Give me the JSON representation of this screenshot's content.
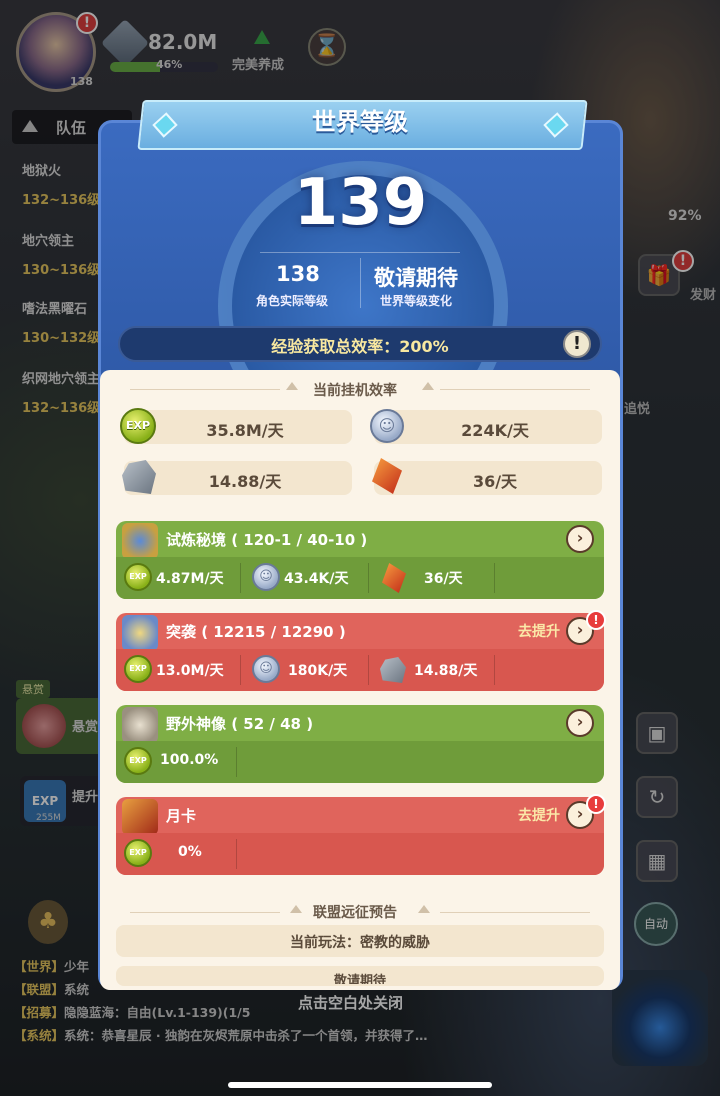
{
  "hud": {
    "avatar_level": "138",
    "power": "82.0M",
    "power_progress": 0.46,
    "power_pct_label": "46%",
    "perfect_label": "完美养成",
    "team_label": "队伍",
    "right_pct": "92%",
    "right_text_1": "发财",
    "right_text_2": "追悦",
    "auto_label": "自动"
  },
  "quests": [
    {
      "name": "地狱火",
      "level": "132~136级"
    },
    {
      "name": "地穴领主",
      "level": "130~136级"
    },
    {
      "name": "嗜法黑曜石",
      "level": "130~132级"
    },
    {
      "name": "织网地穴领主",
      "level": "132~136级"
    }
  ],
  "left_panel": {
    "reward_tag": "悬赏",
    "reward_label": "悬赏",
    "upgrade_label": "提升",
    "exp_amount": "255M"
  },
  "chat": {
    "lines": [
      {
        "channel": "【世界】",
        "text": "少年"
      },
      {
        "channel": "【联盟】",
        "text": "系统"
      },
      {
        "channel": "【招募】",
        "text": "隐隐蓝海：自由(Lv.1-139)(1/5"
      },
      {
        "channel": "【系统】",
        "text": "系统：恭喜星辰 · 独韵在灰烬荒原中击杀了一个首领，并获得了…"
      }
    ],
    "close_hint": "点击空白处关闭"
  },
  "modal": {
    "title": "世界等级",
    "world_level": "139",
    "actual_level": "138",
    "actual_level_caption": "角色实际等级",
    "future_label": "敬请期待",
    "future_caption": "世界等级变化",
    "exp_rate_label": "经验获取总效率：",
    "exp_rate_value": "200%",
    "idle_section_title": "当前挂机效率",
    "idle": {
      "exp": "35.8M/天",
      "coin": "224K/天",
      "stone": "14.88/天",
      "crystal": "36/天"
    },
    "sources": [
      {
        "title": "试炼秘境 ( 120-1 / 40-10 )",
        "exp": "4.87M/天",
        "coin": "43.4K/天",
        "crystal": "36/天",
        "action": ""
      },
      {
        "title": "突袭 ( 12215 / 12290 )",
        "exp": "13.0M/天",
        "coin": "180K/天",
        "stone": "14.88/天",
        "action": "去提升"
      },
      {
        "title": "野外神像 ( 52 / 48 )",
        "exp": "100.0%",
        "action": ""
      },
      {
        "title": "月卡",
        "exp": "0%",
        "action": "去提升"
      }
    ],
    "alliance_section_title": "联盟远征预告",
    "alliance_current": "当前玩法：密教的威胁",
    "alliance_next": "敬请期待"
  }
}
